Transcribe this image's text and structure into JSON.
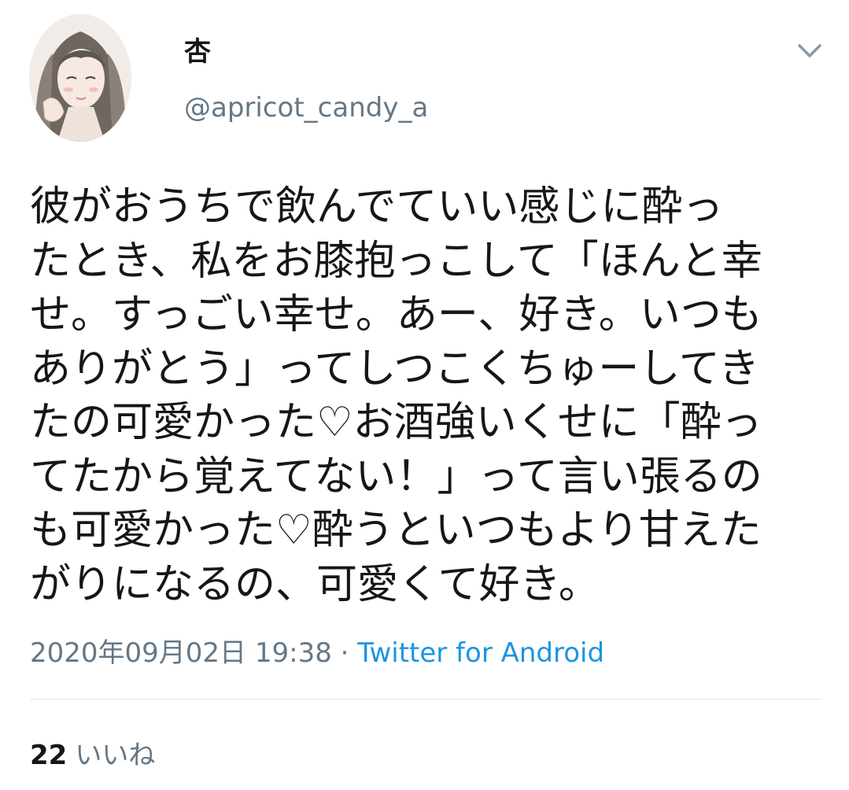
{
  "user": {
    "display_name": "杏",
    "handle": "@apricot_candy_a"
  },
  "tweet": {
    "lines": [
      "彼がおうちで飲んでていい感じに酔っ",
      "たとき、私をお膝抱っこして「ほんと幸",
      "せ。すっごい幸せ。あー、好き。いつも",
      "ありがとう」ってしつこくちゅーしてき",
      "たの可愛かった♡お酒強いくせに「酔っ",
      "てたから覚えてない！」って言い張るの",
      "も可愛かった♡酔うといつもより甘えた",
      "がりになるの、可愛くて好き。"
    ],
    "timestamp": "2020年09月02日 19:38",
    "separator": "·",
    "source": "Twitter for Android"
  },
  "stats": {
    "likes_count": "22",
    "likes_label": "いいね"
  },
  "icons": {
    "menu": "chevron-down-icon",
    "avatar": "avatar"
  },
  "colors": {
    "text": "#14171a",
    "secondary": "#657786",
    "link": "#1b95e0",
    "divider": "#e1e8ed"
  }
}
